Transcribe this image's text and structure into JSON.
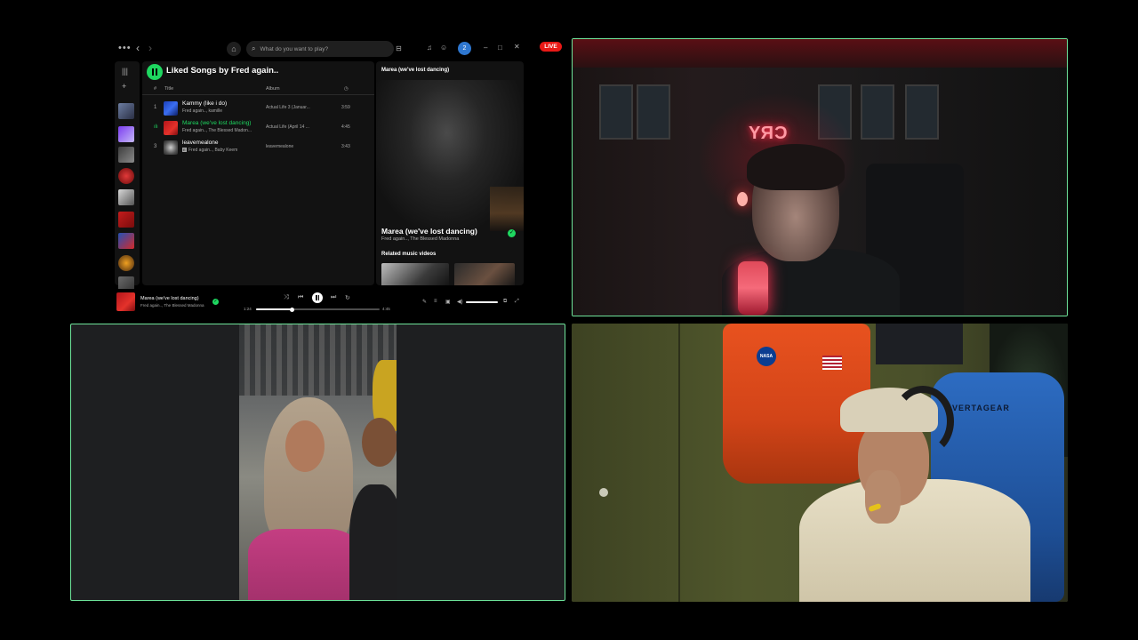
{
  "live_badge": "LIVE",
  "spotify": {
    "titlebar": {
      "menu_icon": "more-horizontal-icon",
      "search_placeholder": "What do you want to play?",
      "avatar_initial": "2"
    },
    "playlist": {
      "title": "Liked Songs by Fred again..",
      "columns": {
        "number": "#",
        "title": "Title",
        "album": "Album"
      },
      "tracks": [
        {
          "num": "1",
          "title": "Kammy (like i do)",
          "artist": "Fred again.., kamille",
          "album": "Actual Life 3 (Januar...",
          "duration": "3:59"
        },
        {
          "num": "",
          "title": "Marea (we've lost dancing)",
          "artist": "Fred again.., The Blessed Madon...",
          "album": "Actual Life (April 14 ...",
          "duration": "4:45"
        },
        {
          "num": "3",
          "title": "leavemealone",
          "artist": "Fred again.., Baby Keem",
          "explicit": "E",
          "album": "leavemealone",
          "duration": "3:43"
        }
      ]
    },
    "now_playing_panel": {
      "header": "Marea (we've lost dancing)",
      "title": "Marea (we've lost dancing)",
      "artist": "Fred again.., The Blessed Madonna",
      "related": "Related music videos"
    },
    "player": {
      "title": "Marea (we've lost dancing)",
      "artist": "Fred again.., The Blessed Madonna",
      "elapsed": "1:24",
      "total": "4:45",
      "progress": 0.29
    }
  },
  "colors": {
    "spotify_green": "#1ed760",
    "tile_border": "#6ee49a",
    "live_red": "#e91916"
  },
  "tiles": {
    "top_right": {
      "neon_sign": "CRY"
    },
    "bottom_right": {
      "chair_brand": "VERTAGEAR",
      "patch": "NASA"
    }
  }
}
